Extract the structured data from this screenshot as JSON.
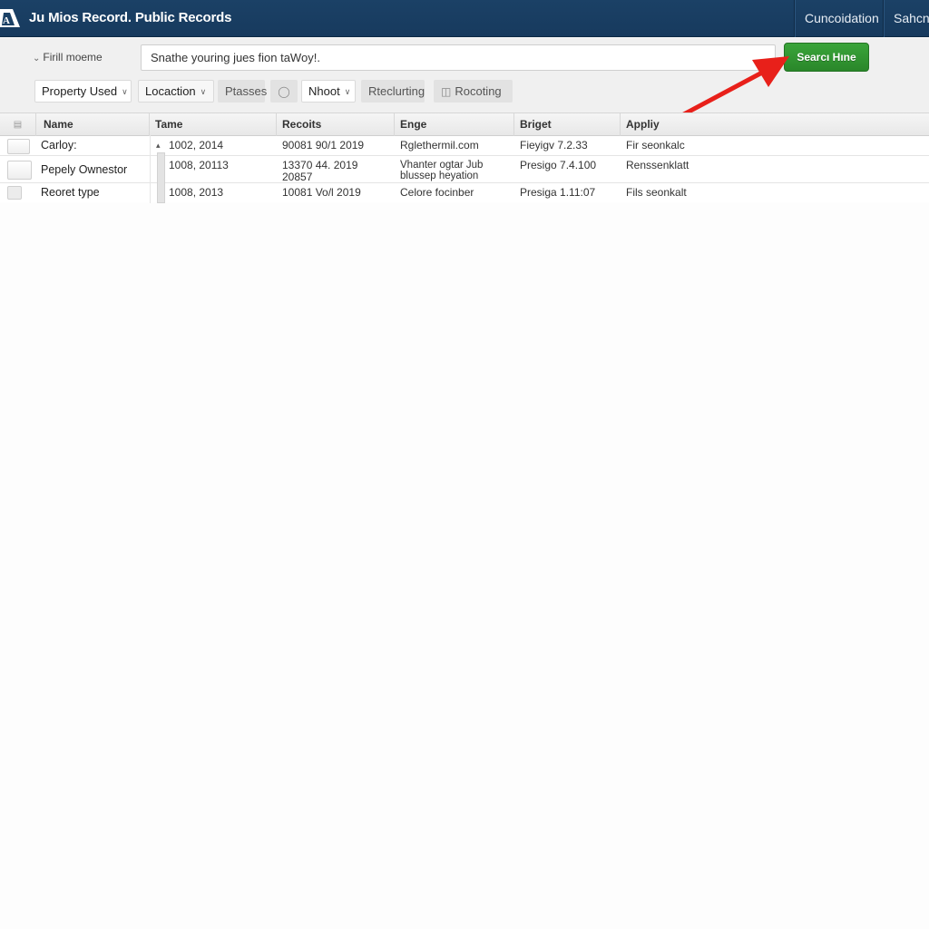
{
  "header": {
    "logo_icon": "mountain-logo-icon",
    "title": "Ju Mios Record. Public Records",
    "nav": [
      {
        "label": "Cuncoidation"
      },
      {
        "label": "Sahcn"
      }
    ],
    "colors": {
      "background": "#1b4166",
      "text": "#ffffff"
    }
  },
  "search": {
    "filter_toggle_label": "Firill moeme",
    "filter_toggle_icon": "chevron-down-icon",
    "input_value": "Snathe youring jues fion taWoy!.",
    "button_label": "Searcı Hıne",
    "button_color": "#2e8f2e"
  },
  "filters": [
    {
      "label": "Property Used",
      "dropdown": true
    },
    {
      "label": "Locaction",
      "dropdown": true
    },
    {
      "label": "Ptasses",
      "dropdown": false
    },
    {
      "label": "",
      "icon": "apple-icon"
    },
    {
      "label": "Nhoot",
      "dropdown": true
    },
    {
      "label": "Rteclurting",
      "dropdown": false
    },
    {
      "label": "Rocoting",
      "icon": "document-icon"
    }
  ],
  "annotation": {
    "arrow_icon": "red-arrow-icon",
    "arrow_color": "#e8201a"
  },
  "table": {
    "columns": [
      "Name",
      "Tame",
      "Recoits",
      "Enge",
      "Briget",
      "Appliy"
    ],
    "rows": [
      {
        "name": "Carloy:",
        "tame": "1002, 2014",
        "recoits": "90081 90/1 2019",
        "enge": "Rglethermil.com",
        "briget": "Fieyigv 7.2.33",
        "apply": "Fir seonkalc"
      },
      {
        "name": "Pepely Ownestor",
        "tame": "1008, 20113",
        "recoits": "13370 44. 2019 20857",
        "enge": "Vhanter ogtar Jub blussep heyation",
        "briget": "Presigo 7.4.100",
        "apply": "Renssenklatt"
      },
      {
        "name": "Reoret type",
        "tame": "1008, 2013",
        "recoits": "10081 Vo/l 2019",
        "enge": "Celore focinber",
        "briget": "Presiga 1.11:07",
        "apply": "Fils seonkalt"
      }
    ]
  }
}
